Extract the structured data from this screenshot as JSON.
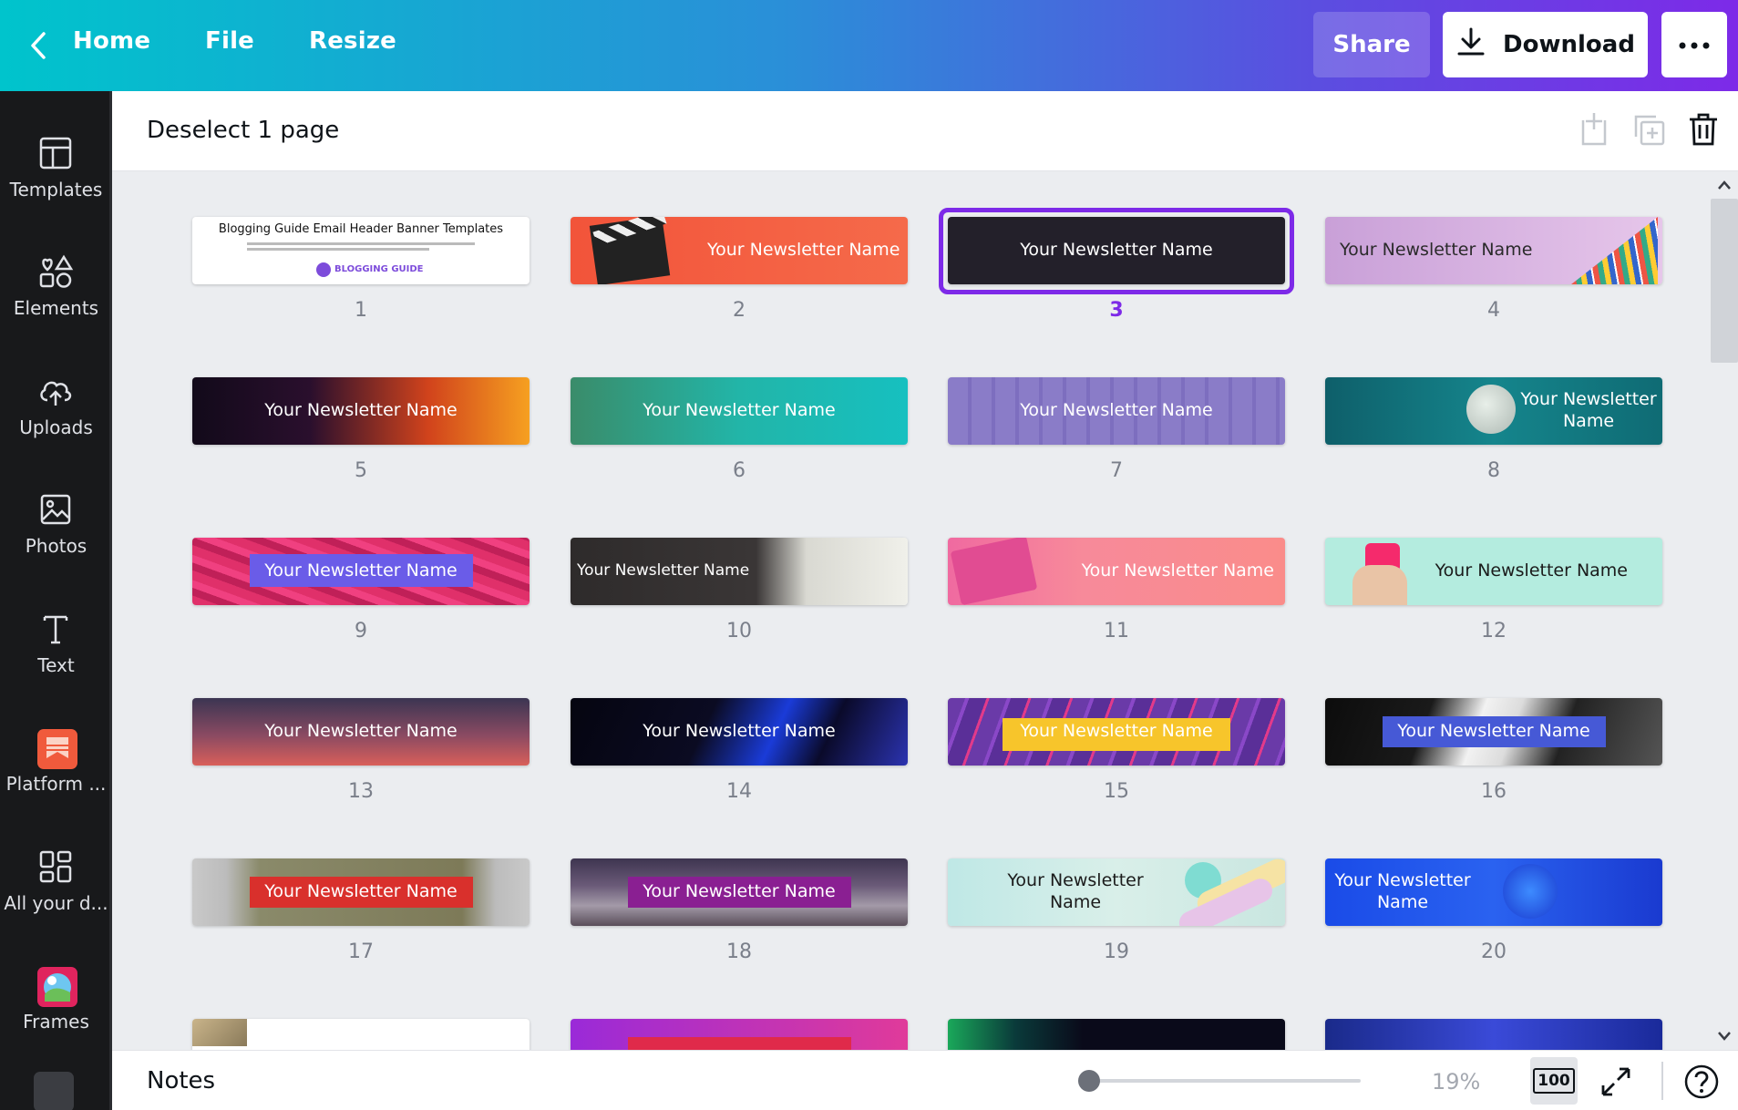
{
  "topbar": {
    "home": "Home",
    "file": "File",
    "resize": "Resize",
    "share": "Share",
    "download": "Download"
  },
  "sidebar": {
    "items": [
      {
        "label": "Templates",
        "icon": "templates-icon"
      },
      {
        "label": "Elements",
        "icon": "elements-icon"
      },
      {
        "label": "Uploads",
        "icon": "uploads-icon"
      },
      {
        "label": "Photos",
        "icon": "photos-icon"
      },
      {
        "label": "Text",
        "icon": "text-icon"
      },
      {
        "label": "Platform ...",
        "icon": "platform-app-icon"
      },
      {
        "label": "All your d...",
        "icon": "all-designs-icon"
      },
      {
        "label": "Frames",
        "icon": "frames-app-icon"
      }
    ]
  },
  "toolbar": {
    "deselect": "Deselect 1 page"
  },
  "pages": [
    {
      "num": "1",
      "text": "Blogging Guide Email Header Banner Templates",
      "sub": "BLOGGING GUIDE"
    },
    {
      "num": "2",
      "text": "Your Newsletter Name"
    },
    {
      "num": "3",
      "text": "Your Newsletter Name",
      "selected": true
    },
    {
      "num": "4",
      "text": "Your Newsletter Name"
    },
    {
      "num": "5",
      "text": "Your Newsletter Name"
    },
    {
      "num": "6",
      "text": "Your Newsletter Name"
    },
    {
      "num": "7",
      "text": "Your Newsletter Name"
    },
    {
      "num": "8",
      "text": "Your Newsletter Name"
    },
    {
      "num": "9",
      "text": "Your Newsletter Name"
    },
    {
      "num": "10",
      "text": "Your Newsletter Name"
    },
    {
      "num": "11",
      "text": "Your Newsletter Name"
    },
    {
      "num": "12",
      "text": "Your Newsletter Name"
    },
    {
      "num": "13",
      "text": "Your Newsletter Name"
    },
    {
      "num": "14",
      "text": "Your Newsletter Name"
    },
    {
      "num": "15",
      "text": "Your Newsletter Name"
    },
    {
      "num": "16",
      "text": "Your Newsletter Name"
    },
    {
      "num": "17",
      "text": "Your Newsletter Name"
    },
    {
      "num": "18",
      "text": "Your Newsletter Name"
    },
    {
      "num": "19",
      "text": "Your Newsletter Name"
    },
    {
      "num": "20",
      "text": "Your Newsletter Name"
    }
  ],
  "notes": {
    "label": "Notes",
    "zoom": "19%",
    "zoom_value": 0.19,
    "fit_label": "100"
  },
  "colors": {
    "accent": "#7d2ae8",
    "sidebar_bg": "#18191b",
    "canvas_bg": "#ebedf0"
  }
}
